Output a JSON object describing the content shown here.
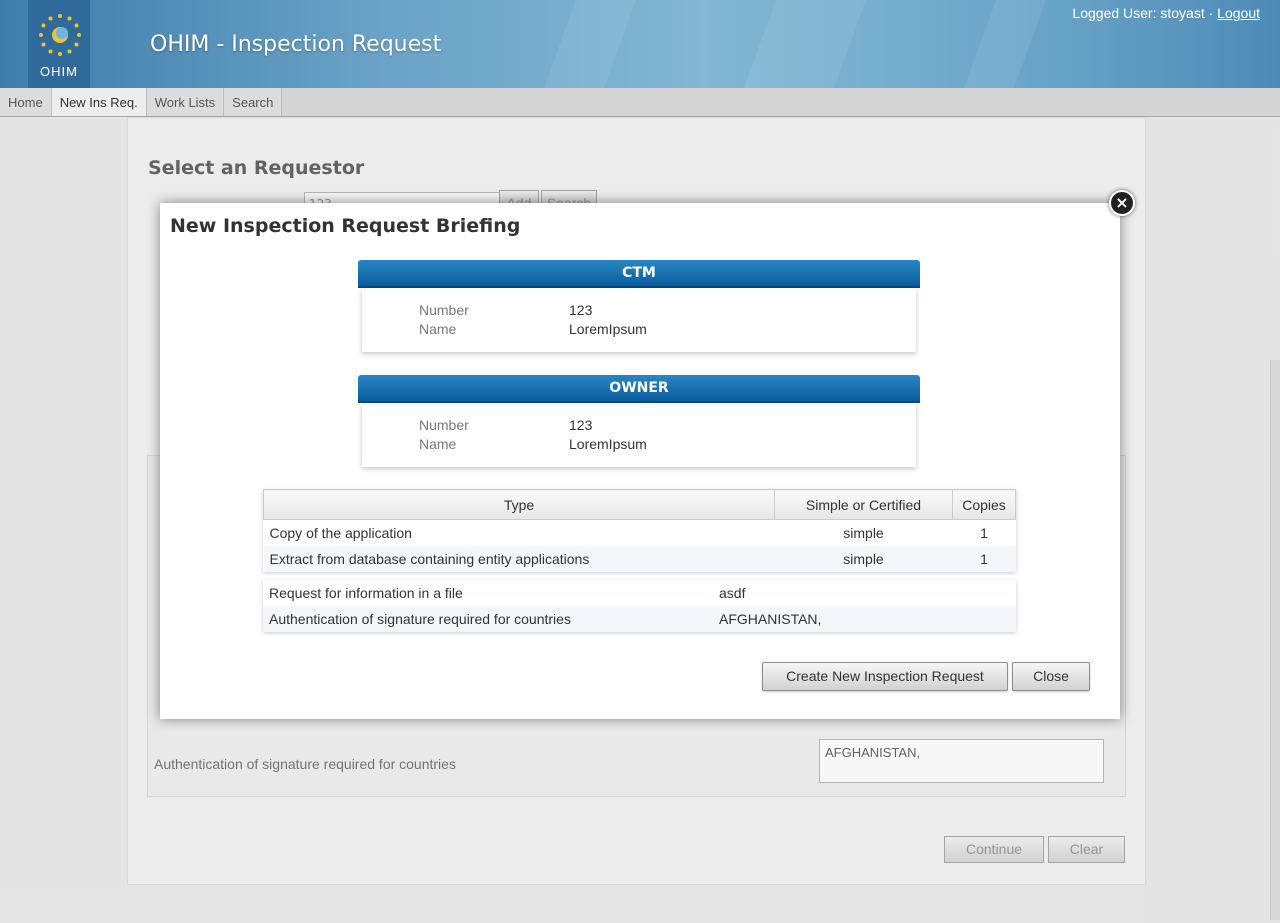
{
  "header": {
    "logo_text": "OHIM",
    "title": "OHIM - Inspection Request",
    "logged_user_prefix": "Logged User: stoyast ·",
    "logout_label": "Logout"
  },
  "nav": {
    "tabs": [
      {
        "label": "Home"
      },
      {
        "label": "New Ins Req."
      },
      {
        "label": "Work Lists"
      },
      {
        "label": "Search"
      }
    ],
    "active": "New Ins Req."
  },
  "background": {
    "heading": "Select an Requestor",
    "id_input_value": "123",
    "add_button": "Add",
    "search_button": "Search",
    "auth_label": "Authentication of signature required for countries",
    "auth_value": "AFGHANISTAN,",
    "continue_button": "Continue",
    "clear_button": "Clear"
  },
  "modal": {
    "title": "New Inspection Request Briefing",
    "ctm": {
      "header": "CTM",
      "number_label": "Number",
      "number_value": "123",
      "name_label": "Name",
      "name_value": "LoremIpsum"
    },
    "owner": {
      "header": "OWNER",
      "number_label": "Number",
      "number_value": "123",
      "name_label": "Name",
      "name_value": "LoremIpsum"
    },
    "types_table": {
      "columns": [
        "Type",
        "Simple or Certified",
        "Copies"
      ],
      "rows": [
        [
          "Copy of the application",
          "simple",
          "1"
        ],
        [
          "Extract from database containing entity applications",
          "simple",
          "1"
        ]
      ]
    },
    "info_table": {
      "rows": [
        [
          "Request for information in a file",
          "asdf"
        ],
        [
          "Authentication of signature required for countries",
          "AFGHANISTAN,"
        ]
      ]
    },
    "create_button": "Create New Inspection Request",
    "close_button": "Close"
  }
}
